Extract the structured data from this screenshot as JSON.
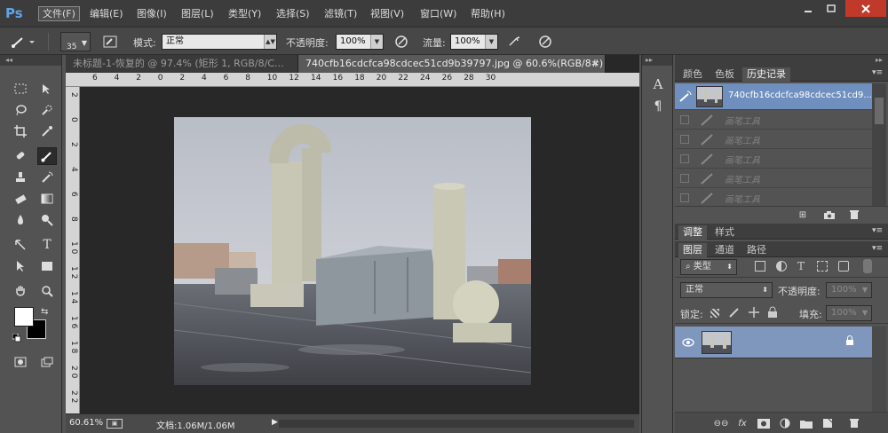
{
  "app": {
    "logo": "Ps"
  },
  "menu": [
    {
      "label": "文件(F)",
      "active": true
    },
    {
      "label": "编辑(E)"
    },
    {
      "label": "图像(I)"
    },
    {
      "label": "图层(L)"
    },
    {
      "label": "类型(Y)"
    },
    {
      "label": "选择(S)"
    },
    {
      "label": "滤镜(T)"
    },
    {
      "label": "视图(V)"
    },
    {
      "label": "窗口(W)"
    },
    {
      "label": "帮助(H)"
    }
  ],
  "options": {
    "brush_size": "35",
    "mode_label": "模式:",
    "mode_value": "正常",
    "opacity_label": "不透明度:",
    "opacity_value": "100%",
    "flow_label": "流量:",
    "flow_value": "100%"
  },
  "tabs": [
    {
      "label": "未标题-1-恢复的 @ 97.4% (矩形 1, RGB/8/C...",
      "active": false
    },
    {
      "label": "740cfb16cdcfca98cdcec51cd9b39797.jpg @ 60.6%(RGB/8#)",
      "active": true
    }
  ],
  "ruler_h": [
    "6",
    "4",
    "2",
    "0",
    "2",
    "4",
    "6",
    "8",
    "10",
    "12",
    "14",
    "16",
    "18",
    "20",
    "22",
    "24",
    "26",
    "28",
    "30"
  ],
  "ruler_v": [
    "2",
    "0",
    "2",
    "4",
    "6",
    "8",
    "1 0",
    "1 2",
    "1 4",
    "1 6",
    "1 8",
    "2 0",
    "2 2"
  ],
  "status": {
    "zoom": "60.61%",
    "doc_info": "文档:1.06M/1.06M"
  },
  "history_panel": {
    "tabs": [
      "颜色",
      "色板",
      "历史记录"
    ],
    "active_tab": "历史记录",
    "snapshot_label": "740cfb16cdcfca98cdcec51cd9...",
    "items": [
      "画笔工具",
      "画笔工具",
      "画笔工具",
      "画笔工具",
      "画笔工具"
    ]
  },
  "adjust_panel": {
    "tabs": [
      "调整",
      "样式"
    ],
    "active_tab": "调整"
  },
  "layers_panel": {
    "tabs": [
      "图层",
      "通道",
      "路径"
    ],
    "active_tab": "图层",
    "filter_label": "类型",
    "blend_mode": "正常",
    "opacity_label": "不透明度:",
    "opacity_value": "100%",
    "lock_label": "锁定:",
    "fill_label": "填充:",
    "fill_value": "100%"
  },
  "colors": {
    "menubar_bg": "#3c3c3c",
    "panel_bg": "#535353",
    "canvas_bg": "#282828",
    "selection_blue": "#6f8fbf",
    "close_red": "#c1392b"
  },
  "icons": [
    "brush-icon",
    "eye-icon",
    "lock-icon",
    "trash-icon",
    "camera-icon",
    "new-layer-icon",
    "move-icon",
    "marquee-icon",
    "lasso-icon",
    "crop-icon",
    "eyedropper-icon",
    "spot-heal-icon",
    "clone-stamp-icon",
    "history-brush-icon",
    "eraser-icon",
    "gradient-icon",
    "blur-icon",
    "dodge-icon",
    "pen-icon",
    "type-icon",
    "path-select-icon",
    "shape-icon",
    "hand-icon",
    "zoom-icon"
  ]
}
